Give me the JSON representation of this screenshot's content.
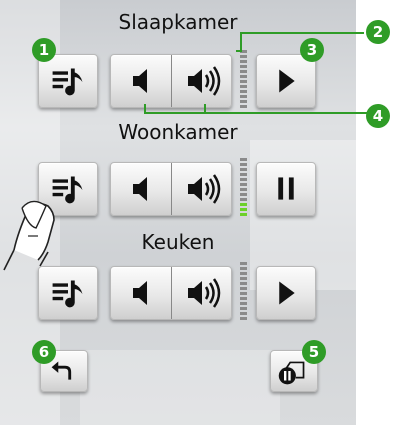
{
  "rooms": [
    {
      "name": "Slaapkamer",
      "state": "play",
      "meter_level": 0
    },
    {
      "name": "Woonkamer",
      "state": "pause",
      "meter_level": 0.25
    },
    {
      "name": "Keuken",
      "state": "play",
      "meter_level": 0
    }
  ],
  "badges": [
    "1",
    "2",
    "3",
    "4",
    "5",
    "6"
  ],
  "colors": {
    "accent": "#2f9c27",
    "meter_on": "#6cd02a",
    "meter_off": "#8a8a8a"
  },
  "icons": {
    "playlist": "playlist-music-icon",
    "volume_down": "volume-down-icon",
    "volume_up": "volume-up-icon",
    "play": "play-icon",
    "pause": "pause-icon",
    "back": "back-arrow-icon",
    "pause_all": "pause-all-icon",
    "finger": "finger-tap-icon"
  }
}
